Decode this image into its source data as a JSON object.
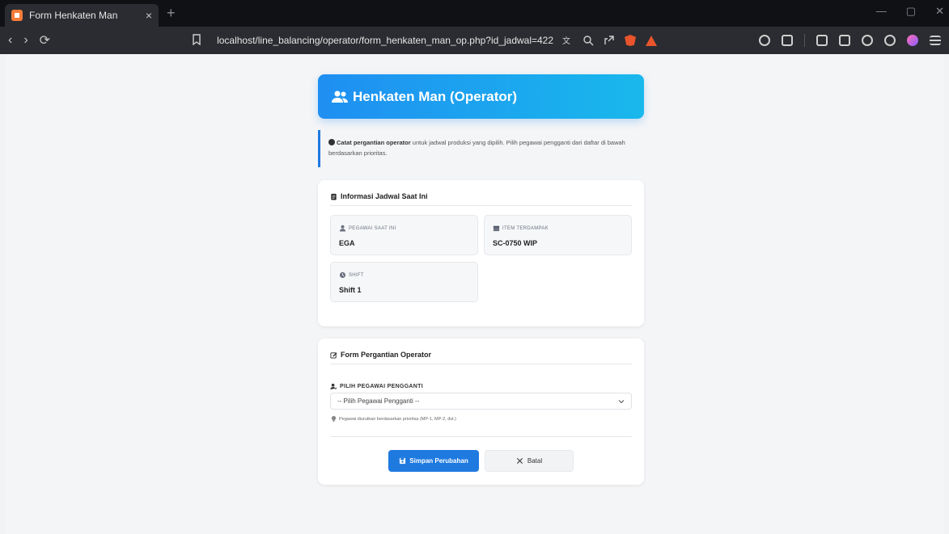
{
  "browser": {
    "tab_title": "Form Henkaten Man",
    "tab_close": "×",
    "new_tab": "+",
    "window_min": "—",
    "window_max": "▢",
    "window_close": "✕",
    "url": "localhost/line_balancing/operator/form_henkaten_man_op.php?id_jadwal=422",
    "nav_back": "‹",
    "nav_forward": "›",
    "nav_reload": "⟳"
  },
  "header": {
    "title": "Henkaten Man (Operator)"
  },
  "alert": {
    "bold": "Catat pergantian operator",
    "text": " untuk jadwal produksi yang dipilih. Pilih pegawai pengganti dari daftar di bawah berdasarkan prioritas."
  },
  "info_card": {
    "title": "Informasi Jadwal Saat Ini",
    "items": [
      {
        "label": "PEGAWAI SAAT INI",
        "value": "EGA",
        "icon": "user-icon"
      },
      {
        "label": "ITEM TERDAMPAK",
        "value": "SC-0750 WIP",
        "icon": "box-icon"
      },
      {
        "label": "SHIFT",
        "value": "Shift 1",
        "icon": "clock-icon"
      }
    ]
  },
  "form_card": {
    "title": "Form Pergantian Operator",
    "field_label": "PILIH PEGAWAI PENGGANTI",
    "select_value": "-- Pilih Pegawai Pengganti --",
    "hint": "Pegawai diurutkan berdasarkan prioritas (MP-1, MP-2, dst.)",
    "save_label": "Simpan Perubahan",
    "cancel_label": "Batal"
  },
  "colors": {
    "accent": "#1f7ae0",
    "banner_start": "#1f8ff2",
    "banner_end": "#19b8ec"
  }
}
